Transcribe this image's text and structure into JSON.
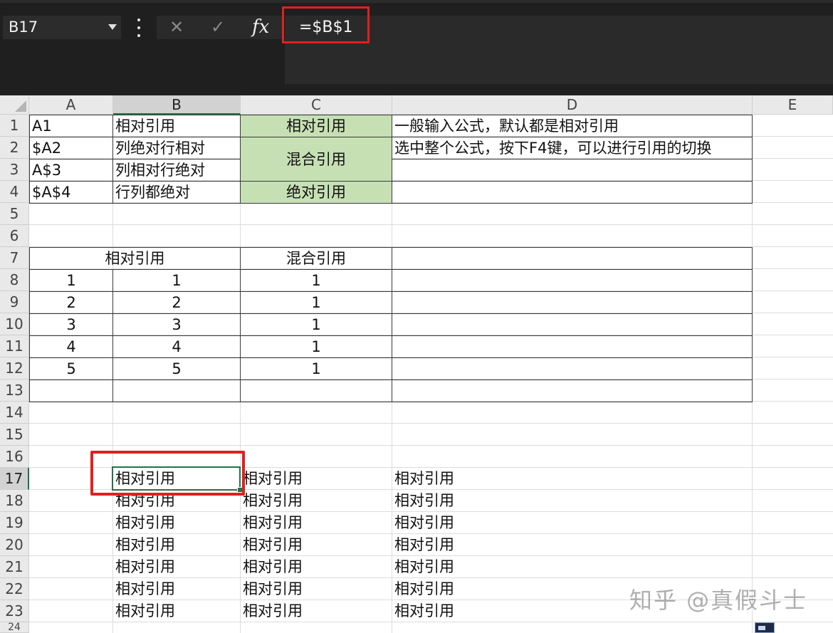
{
  "name_box": {
    "value": "B17"
  },
  "formula_bar": {
    "cancel_icon": "✕",
    "enter_icon": "✓",
    "fx_label": "fx",
    "formula": "=$B$1"
  },
  "column_headers": [
    "A",
    "B",
    "C",
    "D",
    "E"
  ],
  "row_headers": [
    "1",
    "2",
    "3",
    "4",
    "5",
    "6",
    "7",
    "8",
    "9",
    "10",
    "11",
    "12",
    "13",
    "14",
    "15",
    "16",
    "17",
    "18",
    "19",
    "20",
    "21",
    "22",
    "23",
    "24"
  ],
  "selected_cell": "B17",
  "cells": {
    "A1": "A1",
    "B1": "相对引用",
    "C1": "相对引用",
    "D1": "一般输入公式，默认都是相对引用",
    "A2": "$A2",
    "B2": "列绝对行相对",
    "C2_3": "混合引用",
    "D2": "选中整个公式，按下F4键，可以进行引用的切换",
    "A3": "A$3",
    "B3": "列相对行绝对",
    "A4": "$A$4",
    "B4": "行列都绝对",
    "C4": "绝对引用",
    "AB7": "相对引用",
    "C7": "混合引用",
    "A8": "1",
    "B8": "1",
    "C8": "1",
    "A9": "2",
    "B9": "2",
    "C9": "1",
    "A10": "3",
    "B10": "3",
    "C10": "1",
    "A11": "4",
    "B11": "4",
    "C11": "1",
    "A12": "5",
    "B12": "5",
    "C12": "1",
    "B17": "相对引用",
    "C17": "相对引用",
    "D17": "相对引用",
    "B18": "相对引用",
    "C18": "相对引用",
    "D18": "相对引用",
    "B19": "相对引用",
    "C19": "相对引用",
    "D19": "相对引用",
    "B20": "相对引用",
    "C20": "相对引用",
    "D20": "相对引用",
    "B21": "相对引用",
    "C21": "相对引用",
    "D21": "相对引用",
    "B22": "相对引用",
    "C22": "相对引用",
    "D22": "相对引用",
    "B23": "相对引用",
    "C23": "相对引用",
    "D23": "相对引用"
  },
  "watermark": "知乎 @真假斗士",
  "colors": {
    "toolbar_bg": "#1f1f1f",
    "green_fill": "#c6e0b4",
    "selection_green": "#217346",
    "highlight_red": "#e0201e"
  }
}
